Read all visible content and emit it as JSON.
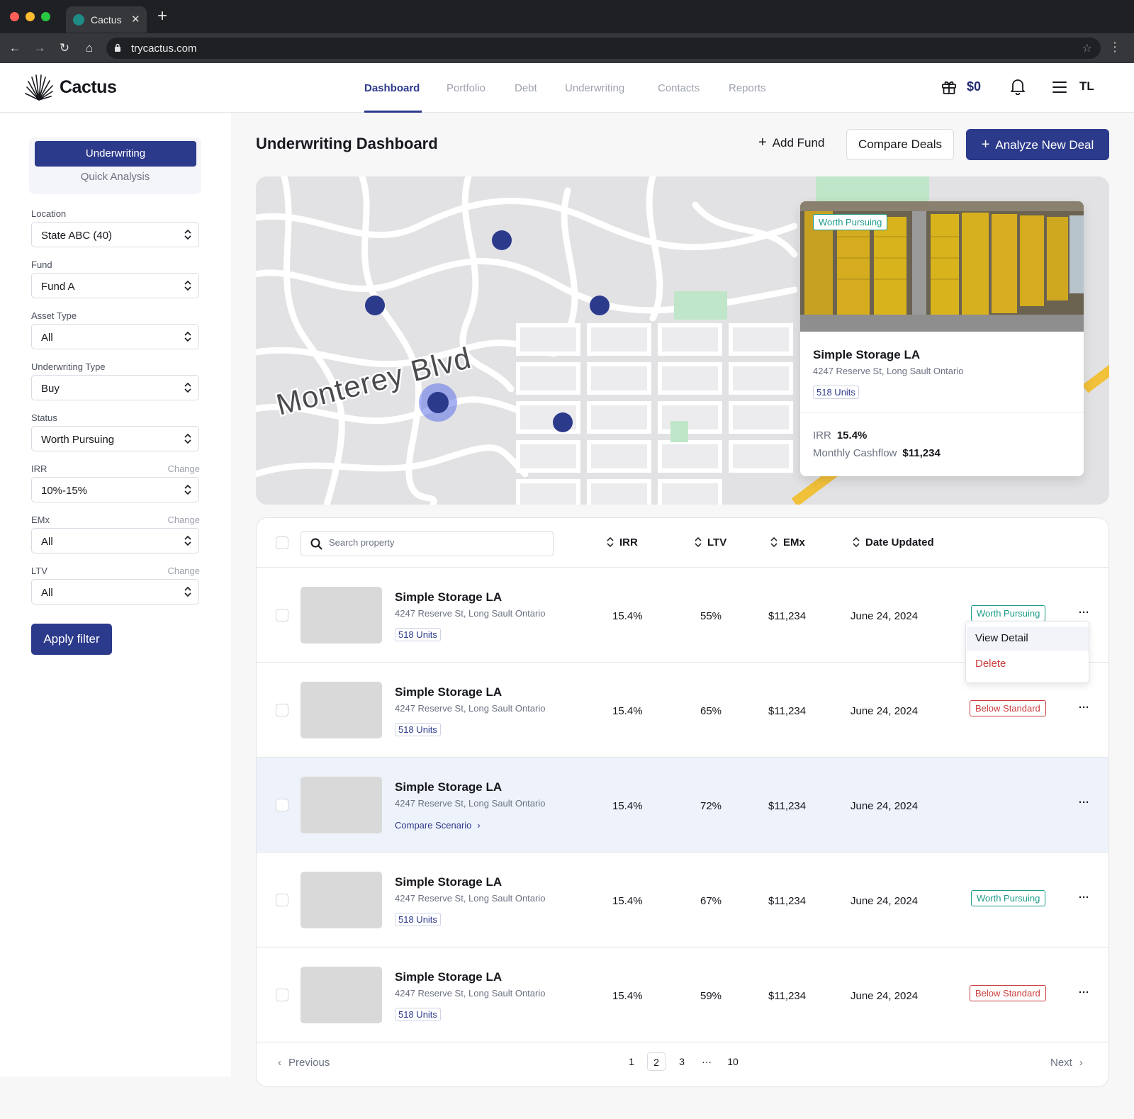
{
  "browser": {
    "tab_title": "Cactus",
    "url": "trycactus.com"
  },
  "header": {
    "brand": "Cactus",
    "nav": [
      "Dashboard",
      "Portfolio",
      "Debt",
      "Underwriting",
      "Contacts",
      "Reports"
    ],
    "active_nav": "Dashboard",
    "credit": "$0",
    "avatar_initials": "TL"
  },
  "sidebar": {
    "mode_active": "Underwriting",
    "mode_other": "Quick Analysis",
    "filters": [
      {
        "label": "Location",
        "value": "State ABC (40)",
        "change": ""
      },
      {
        "label": "Fund",
        "value": "Fund A",
        "change": ""
      },
      {
        "label": "Asset Type",
        "value": "All",
        "change": ""
      },
      {
        "label": "Underwriting Type",
        "value": "Buy",
        "change": ""
      },
      {
        "label": "Status",
        "value": "Worth Pursuing",
        "change": ""
      },
      {
        "label": "IRR",
        "value": "10%-15%",
        "change": "Change"
      },
      {
        "label": "EMx",
        "value": "All",
        "change": "Change"
      },
      {
        "label": "LTV",
        "value": "All",
        "change": "Change"
      }
    ],
    "apply_label": "Apply filter"
  },
  "main": {
    "title": "Underwriting Dashboard",
    "add_fund": "Add Fund",
    "compare_deals": "Compare Deals",
    "analyze_new_deal": "Analyze New Deal"
  },
  "map": {
    "street_label": "Monterey Blvd",
    "popup": {
      "status": "Worth Pursuing",
      "name": "Simple Storage LA",
      "address": "4247 Reserve St, Long Sault Ontario",
      "units": "518 Units",
      "irr_label": "IRR",
      "irr_value": "15.4%",
      "cashflow_label": "Monthly Cashflow",
      "cashflow_value": "$11,234"
    }
  },
  "table": {
    "search_placeholder": "Search property",
    "columns": [
      "IRR",
      "LTV",
      "EMx",
      "Date Updated"
    ],
    "rows": [
      {
        "name": "Simple Storage LA",
        "address": "4247 Reserve St, Long Sault Ontario",
        "sub": "518 Units",
        "irr": "15.4%",
        "ltv": "55%",
        "emx": "$11,234",
        "date": "June 24, 2024",
        "status": "Worth Pursuing"
      },
      {
        "name": "Simple Storage LA",
        "address": "4247 Reserve St, Long Sault Ontario",
        "sub": "518 Units",
        "irr": "15.4%",
        "ltv": "65%",
        "emx": "$11,234",
        "date": "June 24, 2024",
        "status": "Below Standard"
      },
      {
        "name": "Simple Storage LA",
        "address": "4247 Reserve St, Long Sault Ontario",
        "sub": "Compare Scenario",
        "irr": "15.4%",
        "ltv": "72%",
        "emx": "$11,234",
        "date": "June 24, 2024",
        "status": ""
      },
      {
        "name": "Simple Storage LA",
        "address": "4247 Reserve St, Long Sault Ontario",
        "sub": "518 Units",
        "irr": "15.4%",
        "ltv": "67%",
        "emx": "$11,234",
        "date": "June 24, 2024",
        "status": "Worth Pursuing"
      },
      {
        "name": "Simple Storage LA",
        "address": "4247 Reserve St, Long Sault Ontario",
        "sub": "518 Units",
        "irr": "15.4%",
        "ltv": "59%",
        "emx": "$11,234",
        "date": "June 24, 2024",
        "status": "Below Standard"
      }
    ],
    "row_menu": {
      "view": "View Detail",
      "delete": "Delete"
    },
    "pagination": {
      "previous": "Previous",
      "next": "Next",
      "pages": [
        "1",
        "2",
        "3",
        "···",
        "10"
      ],
      "current": "2"
    }
  },
  "colors": {
    "primary": "#2c3a8c",
    "good": "#1c9a8a",
    "bad": "#cc3c3c"
  }
}
